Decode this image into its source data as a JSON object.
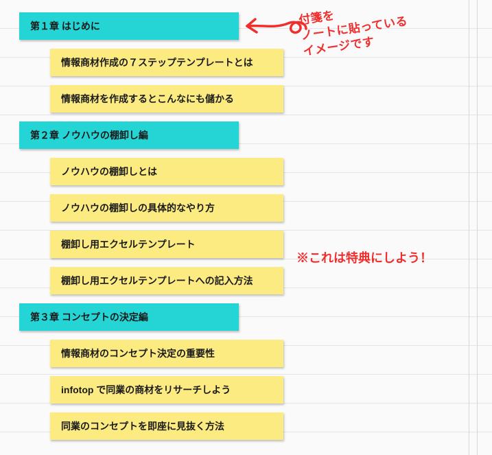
{
  "chapters": [
    {
      "title": "第１章 はじめに",
      "subs": [
        "情報商材作成の７ステップテンプレートとは",
        "情報商材を作成するとこんなにも儲かる"
      ]
    },
    {
      "title": "第２章 ノウハウの棚卸し編",
      "subs": [
        "ノウハウの棚卸しとは",
        "ノウハウの棚卸しの具体的なやり方",
        "棚卸し用エクセルテンプレート",
        "棚卸し用エクセルテンプレートへの記入方法"
      ]
    },
    {
      "title": "第３章 コンセプトの決定編",
      "subs": [
        "情報商材のコンセプト決定の重要性",
        "infotop で同業の商材をリサーチしよう",
        "同業のコンセプトを即座に見抜く方法"
      ]
    }
  ],
  "annotations": {
    "sticky_image": "付箋を\nノートに貼っている\nイメージです",
    "bonus": "※これは特典にしよう！"
  }
}
